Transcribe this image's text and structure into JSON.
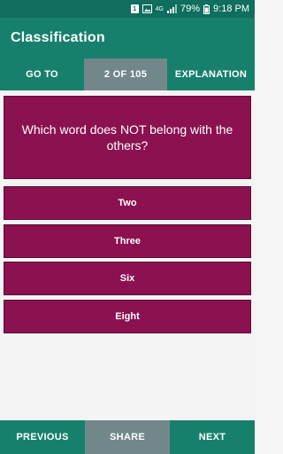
{
  "status_bar": {
    "battery": "79%",
    "time": "9:18 PM",
    "network": "4G",
    "icons": [
      "sim-icon",
      "image-icon",
      "wifi-icon",
      "signal-icon",
      "battery-icon"
    ]
  },
  "app": {
    "title": "Classification"
  },
  "top_tabs": [
    {
      "label": "GO TO"
    },
    {
      "label": "2 OF 105"
    },
    {
      "label": "EXPLANATION"
    }
  ],
  "question": {
    "text": "Which word does NOT belong with the others?"
  },
  "answers": [
    {
      "label": "Two"
    },
    {
      "label": "Three"
    },
    {
      "label": "Six"
    },
    {
      "label": "Eight"
    }
  ],
  "bottom_nav": [
    {
      "label": "PREVIOUS"
    },
    {
      "label": "SHARE"
    },
    {
      "label": "NEXT"
    }
  ],
  "colors": {
    "primary": "#16806d",
    "status_bar": "#0f6e5e",
    "active_tab": "#72878a",
    "card": "#8b1150"
  }
}
